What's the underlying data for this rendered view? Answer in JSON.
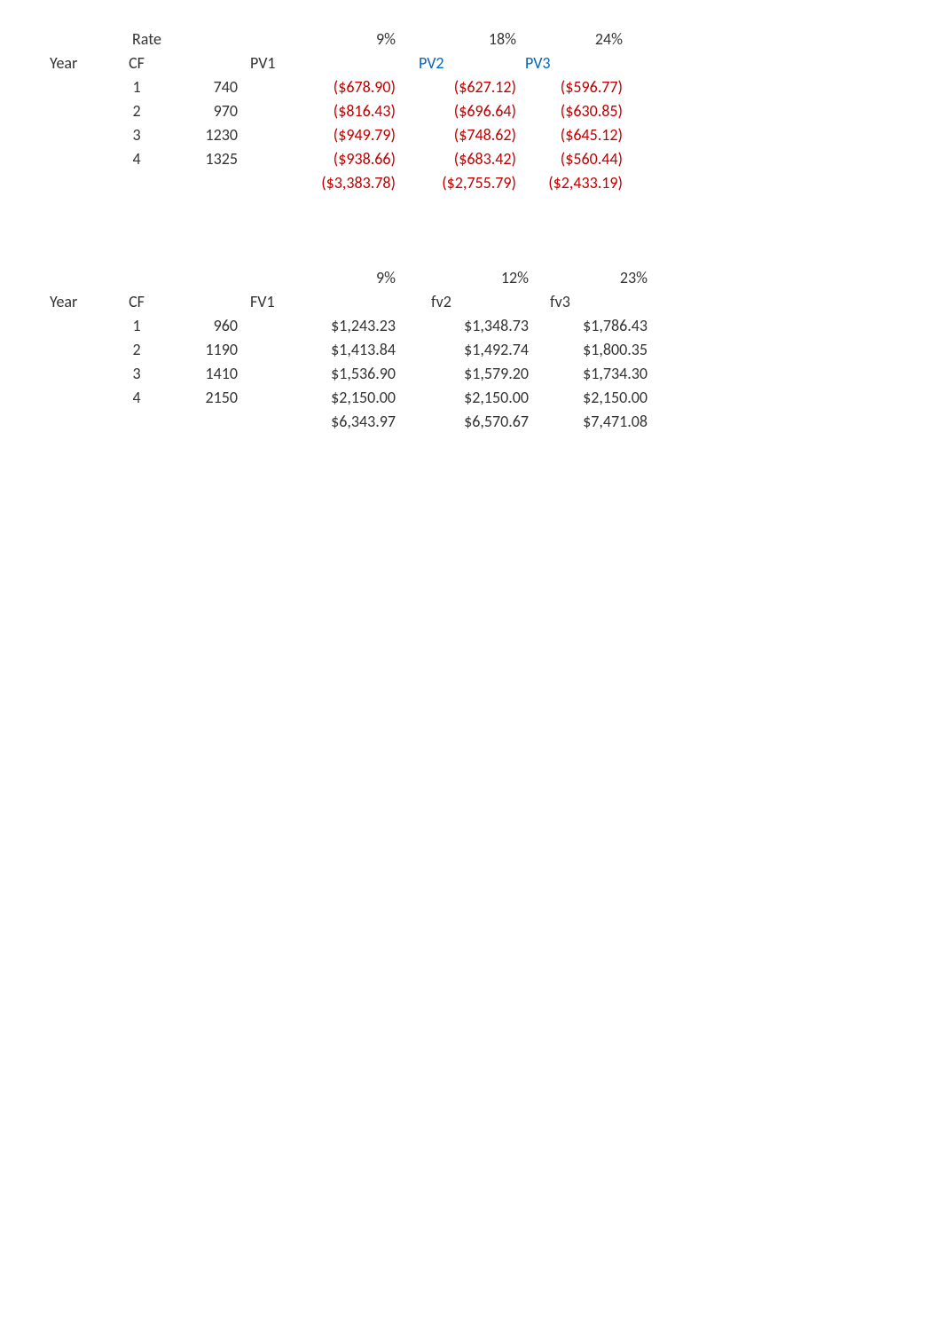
{
  "table1": {
    "rateLabel": "Rate",
    "rates": [
      "9%",
      "18%",
      "24%"
    ],
    "headers": {
      "year": "Year",
      "cf": "CF",
      "pv1": "PV1",
      "pv2": "PV2",
      "pv3": "PV3"
    },
    "rows": [
      {
        "year": "1",
        "cf": "740",
        "v1": "($678.90)",
        "v2": "($627.12)",
        "v3": "($596.77)"
      },
      {
        "year": "2",
        "cf": "970",
        "v1": "($816.43)",
        "v2": "($696.64)",
        "v3": "($630.85)"
      },
      {
        "year": "3",
        "cf": "1230",
        "v1": "($949.79)",
        "v2": "($748.62)",
        "v3": "($645.12)"
      },
      {
        "year": "4",
        "cf": "1325",
        "v1": "($938.66)",
        "v2": "($683.42)",
        "v3": "($560.44)"
      }
    ],
    "totals": {
      "v1": "($3,383.78)",
      "v2": "($2,755.79)",
      "v3": "($2,433.19)"
    }
  },
  "table2": {
    "rates": [
      "9%",
      "12%",
      "23%"
    ],
    "headers": {
      "year": "Year",
      "cf": "CF",
      "fv1": "FV1",
      "fv2": "fv2",
      "fv3": "fv3"
    },
    "rows": [
      {
        "year": "1",
        "cf": "960",
        "v1": "$1,243.23",
        "v2": "$1,348.73",
        "v3": "$1,786.43"
      },
      {
        "year": "2",
        "cf": "1190",
        "v1": "$1,413.84",
        "v2": "$1,492.74",
        "v3": "$1,800.35"
      },
      {
        "year": "3",
        "cf": "1410",
        "v1": "$1,536.90",
        "v2": "$1,579.20",
        "v3": "$1,734.30"
      },
      {
        "year": "4",
        "cf": "2150",
        "v1": "$2,150.00",
        "v2": "$2,150.00",
        "v3": "$2,150.00"
      }
    ],
    "totals": {
      "v1": "$6,343.97",
      "v2": "$6,570.67",
      "v3": "$7,471.08"
    }
  }
}
